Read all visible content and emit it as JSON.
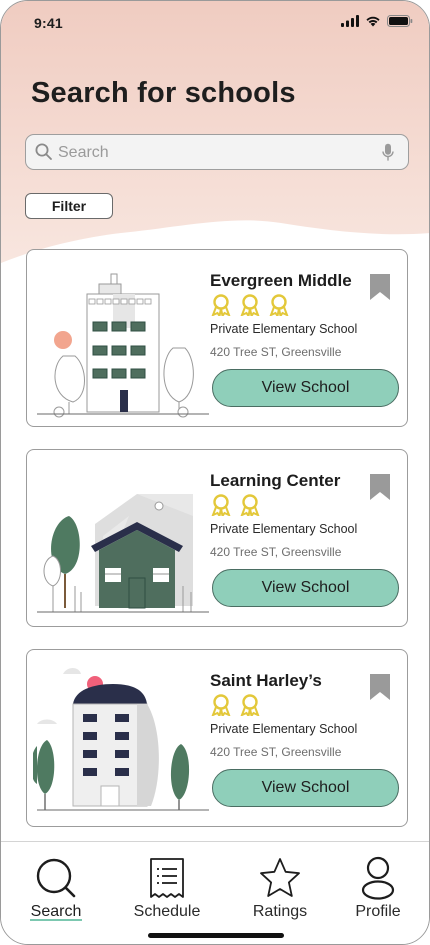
{
  "status_bar": {
    "time": "9:41"
  },
  "header": {
    "title": "Search for schools"
  },
  "search": {
    "placeholder": "Search",
    "value": ""
  },
  "filter": {
    "label": "Filter"
  },
  "schools": [
    {
      "name": "Evergreen Middle",
      "ratings": 3,
      "type": "Private Elementary School",
      "address": "420 Tree ST, Greensville",
      "button": "View School"
    },
    {
      "name": "Learning Center",
      "ratings": 2,
      "type": "Private Elementary School",
      "address": "420 Tree ST, Greensville",
      "button": "View School"
    },
    {
      "name": "Saint Harley’s",
      "ratings": 2,
      "type": "Private Elementary School",
      "address": "420 Tree ST, Greensville",
      "button": "View School"
    }
  ],
  "tabbar": {
    "items": [
      {
        "label": "Search",
        "icon": "search-icon",
        "active": true
      },
      {
        "label": "Schedule",
        "icon": "receipt-icon",
        "active": false
      },
      {
        "label": "Ratings",
        "icon": "star-icon",
        "active": false
      },
      {
        "label": "Profile",
        "icon": "user-icon",
        "active": false
      }
    ]
  },
  "colors": {
    "header_gradient_top": "#f2cfc5",
    "header_gradient_bottom": "#f6e3dc",
    "accent_button": "#8fcfba",
    "ribbon": "#e3c83a",
    "tab_underline": "#7cc8b0"
  }
}
